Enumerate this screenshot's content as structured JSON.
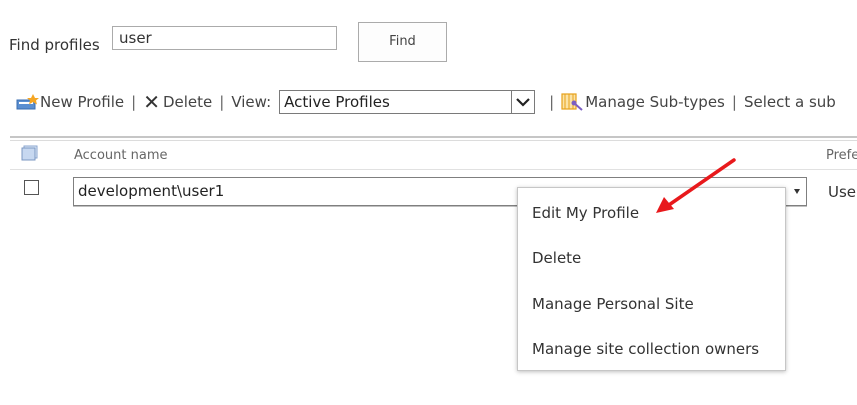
{
  "find": {
    "label": "Find profiles",
    "input_value": "user",
    "button_label": "Find"
  },
  "toolbar": {
    "new_profile": "New Profile",
    "delete": "Delete",
    "view_label": "View:",
    "view_selected": "Active Profiles",
    "manage_subtypes": "Manage Sub-types",
    "select_sub": "Select a sub",
    "separator": "|"
  },
  "list": {
    "columns": [
      "Account name",
      "Prefe"
    ],
    "rows": [
      {
        "account": "development\\user1",
        "pref": "User"
      }
    ]
  },
  "context_menu": {
    "items": [
      "Edit My Profile",
      "Delete",
      "Manage Personal Site",
      "Manage site collection owners"
    ]
  },
  "colors": {
    "annotation_arrow": "#e8191c",
    "new_icon_accent": "#f5a623",
    "manage_icon": "#e7a11a"
  },
  "icons": [
    "new-profile-icon",
    "delete-x-icon",
    "dropdown-arrow-icon",
    "manage-subtypes-icon",
    "select-all-icon"
  ]
}
